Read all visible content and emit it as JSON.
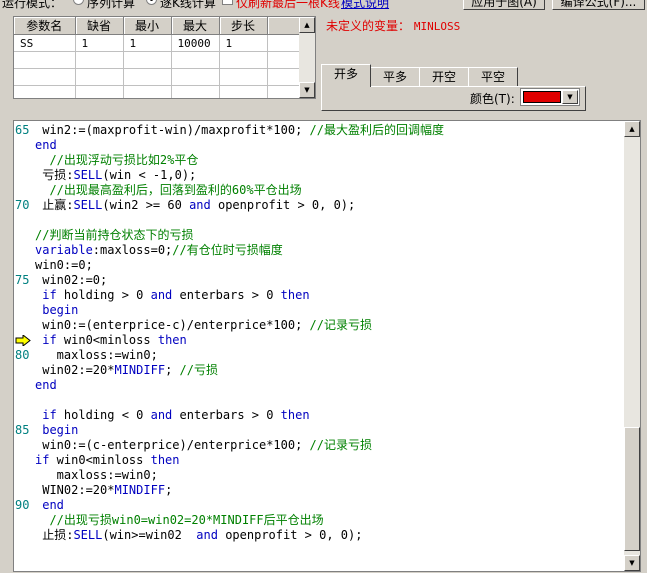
{
  "toolbar": {
    "run_mode_label": "运行模式：",
    "radio_sequence": "序列计算",
    "radio_bar": "逐K线计算",
    "check_last_label": "仅刷新最后一根K线",
    "mode_link": "模式说明",
    "apply_button": "应用于图(A)",
    "compile_button": "编译公式(F)..."
  },
  "param_table": {
    "headers": [
      "参数名",
      "缺省",
      "最小",
      "最大",
      "步长"
    ],
    "rows": [
      [
        "SS",
        "1",
        "1",
        "10000",
        "1"
      ],
      [
        "",
        "",
        "",
        "",
        ""
      ],
      [
        "",
        "",
        "",
        "",
        ""
      ],
      [
        "",
        "",
        "",
        "",
        ""
      ]
    ]
  },
  "undefined_var": {
    "label": "未定义的变量：",
    "value": "MINLOSS",
    "accent": "#e00000"
  },
  "tabs": [
    "开多",
    "平多",
    "开空",
    "平空"
  ],
  "active_tab": "开多",
  "color": {
    "label": "颜色(T):",
    "value": "#e00000"
  },
  "editor": {
    "lines": [
      {
        "n": "65",
        "text": " win2:=(maxprofit-win)/maxprofit*100; //最大盈利后的回调幅度"
      },
      {
        "n": "",
        "text": "end"
      },
      {
        "n": "",
        "text": "  //出现浮动亏损比如2%平仓"
      },
      {
        "n": "",
        "text": " 亏损:SELL(win < -1,0);"
      },
      {
        "n": "",
        "text": "  //出现最高盈利后，回落到盈利的60%平仓出场"
      },
      {
        "n": "70",
        "text": " 止赢:SELL(win2 >= 60 and openprofit > 0, 0);"
      },
      {
        "n": "",
        "text": ""
      },
      {
        "n": "",
        "text": "//判断当前持仓状态下的亏损"
      },
      {
        "n": "",
        "text": "variable:maxloss=0;//有仓位时亏损幅度"
      },
      {
        "n": "",
        "text": "win0:=0;"
      },
      {
        "n": "75",
        "text": " win02:=0;"
      },
      {
        "n": "",
        "text": " if holding > 0 and enterbars > 0 then"
      },
      {
        "n": "",
        "text": " begin"
      },
      {
        "n": "",
        "text": " win0:=(enterprice-c)/enterprice*100; //记录亏损"
      },
      {
        "n": "",
        "text": " if win0<minloss then",
        "marker": true
      },
      {
        "n": "80",
        "text": "   maxloss:=win0;"
      },
      {
        "n": "",
        "text": " win02:=20*MINDIFF; //亏损"
      },
      {
        "n": "",
        "text": "end"
      },
      {
        "n": "",
        "text": ""
      },
      {
        "n": "",
        "text": " if holding < 0 and enterbars > 0 then"
      },
      {
        "n": "85",
        "text": " begin"
      },
      {
        "n": "",
        "text": " win0:=(c-enterprice)/enterprice*100; //记录亏损"
      },
      {
        "n": "",
        "text": "if win0<minloss then"
      },
      {
        "n": "",
        "text": "   maxloss:=win0;"
      },
      {
        "n": "",
        "text": " WIN02:=20*MINDIFF;"
      },
      {
        "n": "90",
        "text": " end"
      },
      {
        "n": "",
        "text": "  //出现亏损win0=win02=20*MINDIFF后平仓出场"
      },
      {
        "n": "",
        "text": " 止损:SELL(win>=win02  and openprofit > 0, 0);"
      }
    ]
  }
}
